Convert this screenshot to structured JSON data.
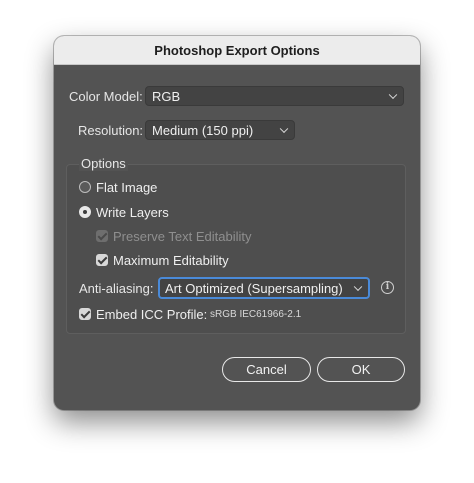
{
  "dialog": {
    "title": "Photoshop Export Options"
  },
  "color_model": {
    "label": "Color Model:",
    "value": "RGB"
  },
  "resolution": {
    "label": "Resolution:",
    "value": "Medium (150 ppi)"
  },
  "options": {
    "group_label": "Options",
    "flat_image": {
      "label": "Flat Image",
      "selected": false
    },
    "write_layers": {
      "label": "Write Layers",
      "selected": true
    },
    "preserve_text": {
      "label": "Preserve Text Editability",
      "checked": true,
      "enabled": false
    },
    "maximum_editability": {
      "label": "Maximum Editability",
      "checked": true,
      "enabled": true
    },
    "anti_aliasing": {
      "label": "Anti-aliasing:",
      "value": "Art Optimized (Supersampling)"
    },
    "embed_icc": {
      "label": "Embed ICC Profile:",
      "checked": true,
      "profile": "sRGB IEC61966-2.1"
    }
  },
  "buttons": {
    "cancel": "Cancel",
    "ok": "OK"
  },
  "icons": {
    "info": "info-icon",
    "dropdown": "chevron-down-icon"
  },
  "colors": {
    "dialog_bg": "#535353",
    "titlebar_bg": "#ececec",
    "focus_ring": "#4a8ad8"
  }
}
